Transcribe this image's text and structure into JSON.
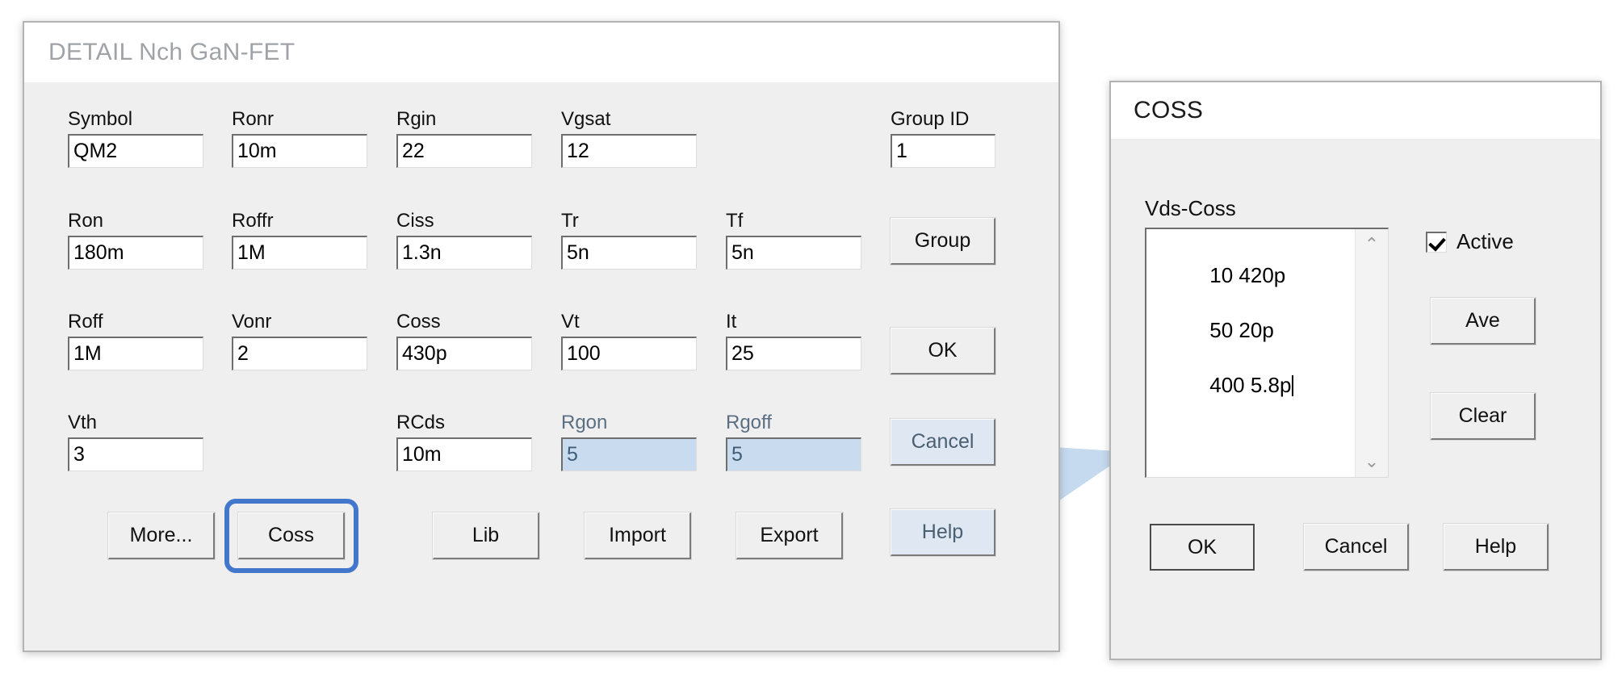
{
  "detail_dialog": {
    "title": "DETAIL Nch GaN-FET",
    "fields": [
      {
        "label": "Symbol",
        "value": "QM2",
        "disabled": false
      },
      {
        "label": "Ronr",
        "value": "10m",
        "disabled": false
      },
      {
        "label": "Rgin",
        "value": "22",
        "disabled": false
      },
      {
        "label": "Vgsat",
        "value": "12",
        "disabled": false
      },
      {
        "label": "Group ID",
        "value": "1",
        "disabled": false
      },
      {
        "label": "Ron",
        "value": "180m",
        "disabled": false
      },
      {
        "label": "Roffr",
        "value": "1M",
        "disabled": false
      },
      {
        "label": "Ciss",
        "value": "1.3n",
        "disabled": false
      },
      {
        "label": "Tr",
        "value": "5n",
        "disabled": false
      },
      {
        "label": "Tf",
        "value": "5n",
        "disabled": false
      },
      {
        "label": "Roff",
        "value": "1M",
        "disabled": false
      },
      {
        "label": "Vonr",
        "value": "2",
        "disabled": false
      },
      {
        "label": "Coss",
        "value": "430p",
        "disabled": false
      },
      {
        "label": "Vt",
        "value": "100",
        "disabled": false
      },
      {
        "label": "It",
        "value": "25",
        "disabled": false
      },
      {
        "label": "Vth",
        "value": "3",
        "disabled": false
      },
      {
        "label": "RCds",
        "value": "10m",
        "disabled": false
      },
      {
        "label": "Rgon",
        "value": "5",
        "disabled": true
      },
      {
        "label": "Rgoff",
        "value": "5",
        "disabled": true
      }
    ],
    "side_buttons": [
      {
        "label": "Group",
        "dim": false
      },
      {
        "label": "OK",
        "dim": false
      },
      {
        "label": "Cancel",
        "dim": true
      },
      {
        "label": "Help",
        "dim": true
      }
    ],
    "bottom_buttons": [
      {
        "label": "More...",
        "highlighted": false
      },
      {
        "label": "Coss",
        "highlighted": true
      },
      {
        "label": "Lib",
        "highlighted": false
      },
      {
        "label": "Import",
        "highlighted": false
      },
      {
        "label": "Export",
        "highlighted": false
      }
    ]
  },
  "coss_dialog": {
    "title": "COSS",
    "list_label": "Vds-Coss",
    "list_lines": [
      "10 420p",
      "50 20p",
      "400 5.8p"
    ],
    "active_checkbox": {
      "label": "Active",
      "checked": true
    },
    "side_buttons": [
      {
        "label": "Ave"
      },
      {
        "label": "Clear"
      }
    ],
    "bottom_buttons": [
      {
        "label": "OK",
        "default": true
      },
      {
        "label": "Cancel",
        "default": false
      },
      {
        "label": "Help",
        "default": false
      }
    ],
    "scrollbar": {
      "up": "⌃",
      "down": "⌄"
    }
  },
  "annotation": {
    "arrow_color": "#c3d8ee",
    "highlight_color": "#4277cc"
  }
}
